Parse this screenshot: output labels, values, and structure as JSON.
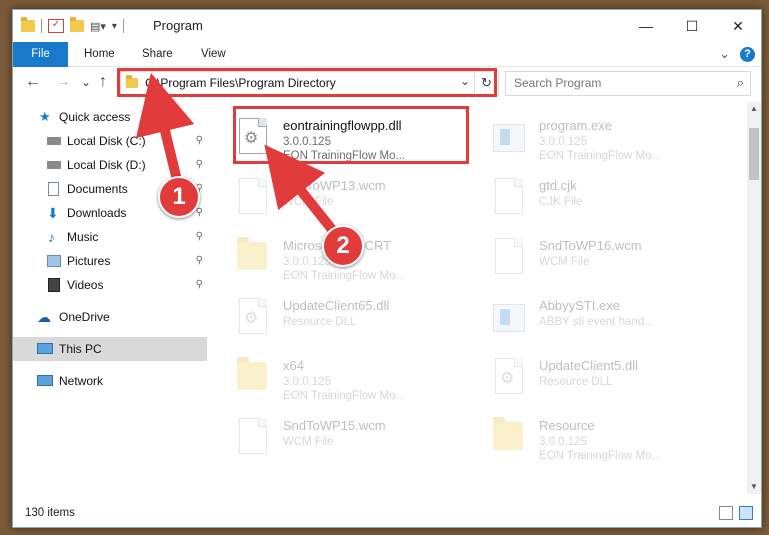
{
  "window": {
    "title": "Program",
    "minimize": "—",
    "maximize": "☐",
    "close": "✕"
  },
  "ribbon": {
    "tabs": [
      "File",
      "Home",
      "Share",
      "View"
    ],
    "expand": "⌄",
    "help": "?"
  },
  "nav": {
    "back": "←",
    "forward": "→",
    "recent": "⌄",
    "up": "↑",
    "address": "C:\\Program Files\\Program Directory",
    "address_dropdown": "⌄",
    "refresh": "↻",
    "search_placeholder": "Search Program",
    "search_icon": "⌕"
  },
  "sidebar": {
    "items": [
      {
        "label": "Quick access",
        "icon": "star-icon",
        "pinned": false
      },
      {
        "label": "Local Disk (C:)",
        "icon": "drive-icon",
        "pinned": true
      },
      {
        "label": "Local Disk (D:)",
        "icon": "drive-icon",
        "pinned": true
      },
      {
        "label": "Documents",
        "icon": "documents-icon",
        "pinned": true
      },
      {
        "label": "Downloads",
        "icon": "download-icon",
        "pinned": true
      },
      {
        "label": "Music",
        "icon": "music-icon",
        "pinned": true
      },
      {
        "label": "Pictures",
        "icon": "pictures-icon",
        "pinned": true
      },
      {
        "label": "Videos",
        "icon": "videos-icon",
        "pinned": true
      },
      {
        "label": "OneDrive",
        "icon": "cloud-icon",
        "pinned": false
      },
      {
        "label": "This PC",
        "icon": "computer-icon",
        "pinned": false,
        "selected": true
      },
      {
        "label": "Network",
        "icon": "network-icon",
        "pinned": false
      }
    ],
    "pin_glyph": "📌"
  },
  "files": [
    {
      "name": "eontrainingflowpp.dll",
      "sub1": "3.0.0.125",
      "sub2": "EON TrainingFlow Mo...",
      "icon": "dll",
      "highlighted": true
    },
    {
      "name": "program.exe",
      "sub1": "3.0.0.125",
      "sub2": "EON TrainingFlow Mo...",
      "icon": "app"
    },
    {
      "name": "SndToWP13.wcm",
      "sub1": "WCM File",
      "sub2": "",
      "icon": "doc"
    },
    {
      "name": "gtd.cjk",
      "sub1": "CJK File",
      "sub2": "",
      "icon": "doc"
    },
    {
      "name": "Microsoft...90.CRT",
      "sub1": "3.0.0.125",
      "sub2": "EON TrainingFlow Mo...",
      "icon": "folder"
    },
    {
      "name": "SndToWP16.wcm",
      "sub1": "WCM File",
      "sub2": "",
      "icon": "doc"
    },
    {
      "name": "UpdateClient65.dll",
      "sub1": "Resource DLL",
      "sub2": "",
      "icon": "dll"
    },
    {
      "name": "AbbyySTI.exe",
      "sub1": "ABBY sti event hand...",
      "sub2": "",
      "icon": "app"
    },
    {
      "name": "x64",
      "sub1": "3.0.0.125",
      "sub2": "EON TrainingFlow Mo...",
      "icon": "folder"
    },
    {
      "name": "UpdateClient5.dll",
      "sub1": "Resource DLL",
      "sub2": "",
      "icon": "dll"
    },
    {
      "name": "SndToWP15.wcm",
      "sub1": "WCM File",
      "sub2": "",
      "icon": "doc"
    },
    {
      "name": "Resource",
      "sub1": "3.0.0.125",
      "sub2": "EON TrainingFlow Mo...",
      "icon": "folder"
    }
  ],
  "status": {
    "count": "130 items"
  },
  "annotations": {
    "step1": "1",
    "step2": "2",
    "color": "#e23b3b"
  },
  "colors": {
    "accent": "#1979ca",
    "selection": "#d9d9d9"
  }
}
